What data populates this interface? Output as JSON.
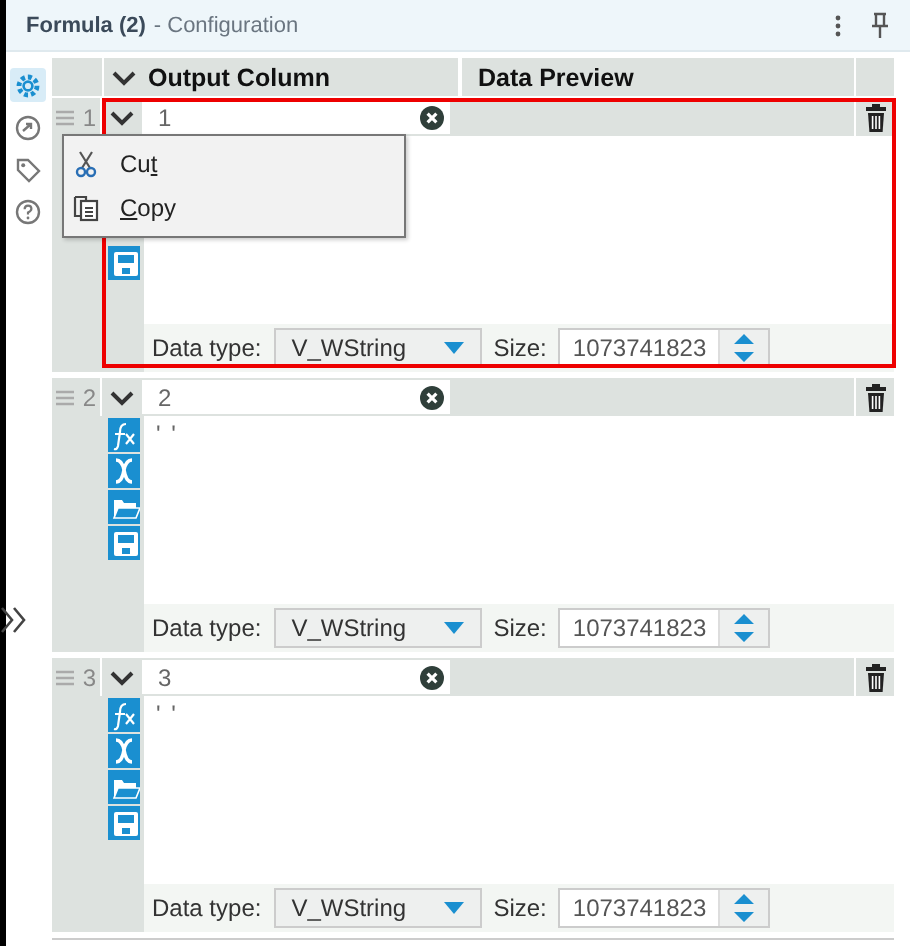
{
  "panel": {
    "title": "Formula (2)",
    "subtitle": "- Configuration"
  },
  "side_tabs": [
    {
      "kind": "settings",
      "selected": true
    },
    {
      "kind": "annotation",
      "selected": false
    },
    {
      "kind": "tag",
      "selected": false
    },
    {
      "kind": "help",
      "selected": false
    }
  ],
  "columns": [
    "Output Column",
    "Data Preview"
  ],
  "rows": [
    {
      "number": "1",
      "name": "1",
      "expanded": true,
      "highlighted": true,
      "tools": [
        {
          "kind": "save"
        }
      ],
      "data_type_label": "Data type:",
      "data_type": "V_WString",
      "size_label": "Size:",
      "size": "1073741823"
    },
    {
      "number": "2",
      "name": "2",
      "expanded": true,
      "highlighted": false,
      "expression": "' '",
      "tools": [
        {
          "kind": "formula"
        },
        {
          "kind": "variable"
        },
        {
          "kind": "open"
        },
        {
          "kind": "save"
        }
      ],
      "data_type_label": "Data type:",
      "data_type": "V_WString",
      "size_label": "Size:",
      "size": "1073741823"
    },
    {
      "number": "3",
      "name": "3",
      "expanded": true,
      "highlighted": false,
      "expression": "' '",
      "tools": [
        {
          "kind": "formula"
        },
        {
          "kind": "variable"
        },
        {
          "kind": "open"
        },
        {
          "kind": "save"
        }
      ],
      "data_type_label": "Data type:",
      "data_type": "V_WString",
      "size_label": "Size:",
      "size": "1073741823"
    }
  ],
  "context_menu": {
    "items": [
      {
        "kind": "cut",
        "label_before_key": "Cu",
        "access_key": "t"
      },
      {
        "kind": "copy",
        "access_key": "C",
        "label_after_key": "opy"
      }
    ]
  }
}
